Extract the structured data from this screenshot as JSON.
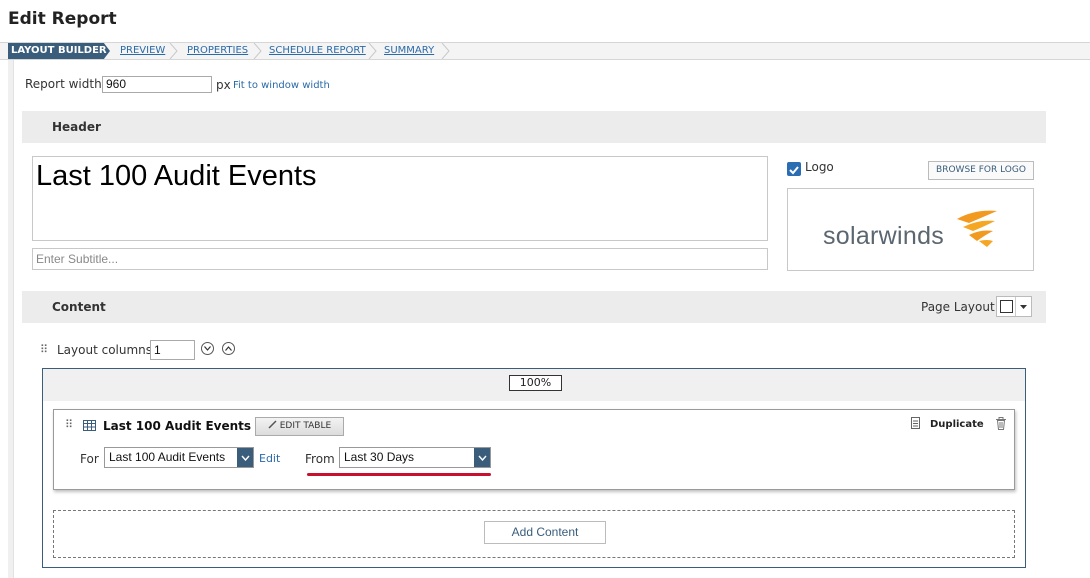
{
  "page": {
    "title": "Edit Report"
  },
  "steps": [
    {
      "label": "LAYOUT BUILDER",
      "active": true
    },
    {
      "label": "PREVIEW",
      "active": false
    },
    {
      "label": "PROPERTIES",
      "active": false
    },
    {
      "label": "SCHEDULE REPORT",
      "active": false
    },
    {
      "label": "SUMMARY",
      "active": false
    }
  ],
  "report_width": {
    "label": "Report width",
    "value": "960",
    "unit": "px",
    "fit_link": "Fit to window width"
  },
  "header_section": {
    "heading": "Header",
    "title_value": "Last 100 Audit Events",
    "subtitle_placeholder": "Enter Subtitle...",
    "logo_label": "Logo",
    "logo_checked": true,
    "browse_label": "BROWSE FOR LOGO",
    "logo_wordmark": "solarwinds"
  },
  "content_section": {
    "heading": "Content",
    "page_layout_label": "Page Layout",
    "layout_columns_label": "Layout columns",
    "layout_columns_value": "1",
    "column_width": "100%"
  },
  "card": {
    "title": "Last 100 Audit Events",
    "edit_table_label": "EDIT TABLE",
    "duplicate_label": "Duplicate",
    "for_label": "For",
    "for_value": "Last 100 Audit Events",
    "edit_link": "Edit",
    "from_label": "From",
    "from_value": "Last 30 Days"
  },
  "add_content_label": "Add Content",
  "colors": {
    "accent": "#3a5d7c",
    "link": "#2a6aa8",
    "highlight": "#c8102e",
    "logo_orange": "#f29a1f"
  }
}
